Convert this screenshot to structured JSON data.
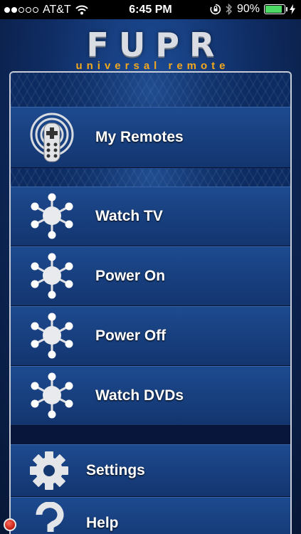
{
  "status_bar": {
    "carrier": "AT&T",
    "signal_bars_filled": 2,
    "signal_bars_total": 5,
    "time": "6:45 PM",
    "battery": "90%",
    "battery_level": 0.9
  },
  "logo": {
    "title": "FUPR",
    "subtitle": "universal remote"
  },
  "menu": {
    "my_remotes": "My Remotes",
    "watch_tv": "Watch TV",
    "power_on": "Power On",
    "power_off": "Power Off",
    "watch_dvds": "Watch DVDs",
    "settings": "Settings",
    "help": "Help"
  },
  "colors": {
    "accent": "#f2a81d",
    "row_text": "#ffffff",
    "battery_green": "#4cd964"
  }
}
